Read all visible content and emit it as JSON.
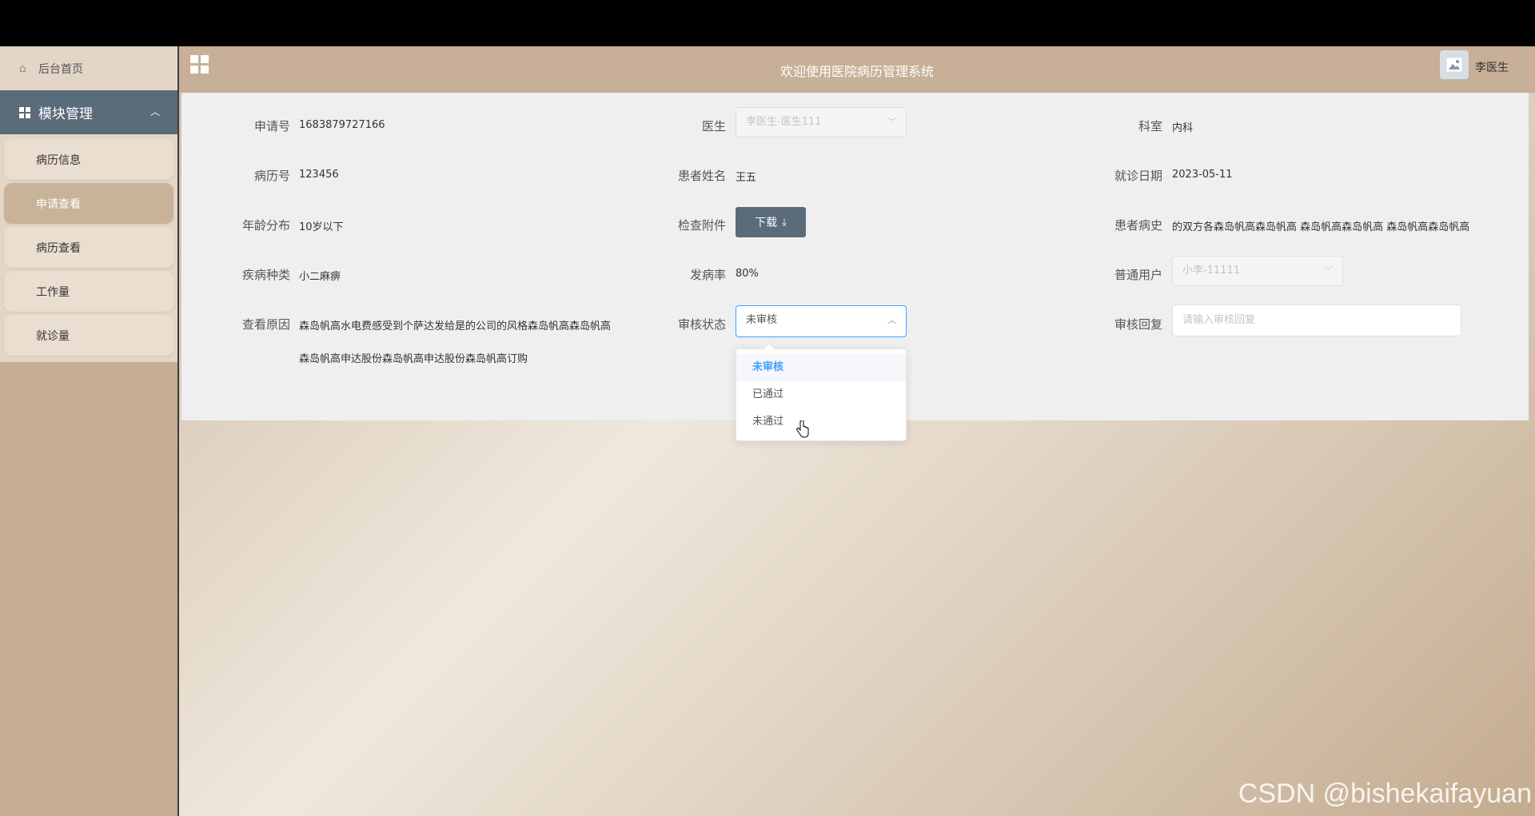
{
  "header": {
    "title": "欢迎使用医院病历管理系统",
    "username": "李医生"
  },
  "sidebar": {
    "home": "后台首页",
    "group": "模块管理",
    "items": [
      {
        "label": "病历信息",
        "active": false
      },
      {
        "label": "申请查看",
        "active": true
      },
      {
        "label": "病历查看",
        "active": false
      },
      {
        "label": "工作量",
        "active": false
      },
      {
        "label": "就诊量",
        "active": false
      }
    ]
  },
  "form": {
    "apply_no": {
      "label": "申请号",
      "value": "1683879727166"
    },
    "doctor": {
      "label": "医生",
      "value": "李医生-医生111"
    },
    "department": {
      "label": "科室",
      "value": "内科"
    },
    "record_no": {
      "label": "病历号",
      "value": "123456"
    },
    "patient_name": {
      "label": "患者姓名",
      "value": "王五"
    },
    "visit_date": {
      "label": "就诊日期",
      "value": "2023-05-11"
    },
    "age_group": {
      "label": "年龄分布",
      "value": "10岁以下"
    },
    "attachment": {
      "label": "检查附件",
      "button": "下载"
    },
    "history": {
      "label": "患者病史",
      "value": "的双方各森岛帆高森岛帆高 森岛帆高森岛帆高 森岛帆高森岛帆高"
    },
    "disease_type": {
      "label": "疾病种类",
      "value": "小二麻痹"
    },
    "incidence": {
      "label": "发病率",
      "value": "80%"
    },
    "normal_user": {
      "label": "普通用户",
      "value": "小李-11111"
    },
    "view_reason": {
      "label": "查看原因",
      "line1": "森岛帆高水电费感受到个萨达发给是的公司的风格森岛帆高森岛帆高",
      "line2": "森岛帆高申达股份森岛帆高申达股份森岛帆高订购"
    },
    "review_status": {
      "label": "审核状态",
      "value": "未审核",
      "options": [
        "未审核",
        "已通过",
        "未通过"
      ]
    },
    "review_reply": {
      "label": "审核回复",
      "placeholder": "请输入审核回复"
    }
  },
  "watermark": "CSDN @bishekaifayuan"
}
